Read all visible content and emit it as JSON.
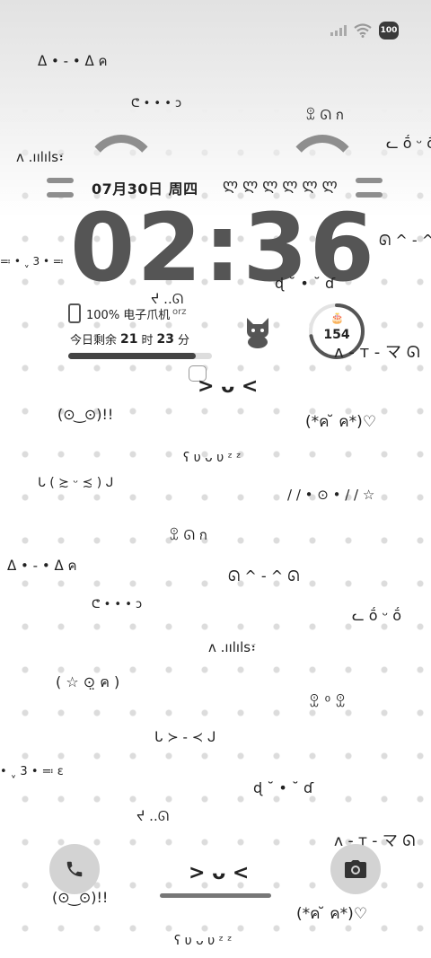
{
  "status_bar": {
    "battery": "100",
    "signal_icon": "signal-icon",
    "wifi_icon": "wifi-icon"
  },
  "lock": {
    "date": "07月30日 周四",
    "header_faces": "ლ ლ ლ ლ ლ ლ",
    "time": "02:36",
    "phone_usage": "100% 电子爪机",
    "orz": "orz",
    "remaining_prefix": "今日剩余",
    "remaining_hours": "21",
    "remaining_hours_unit": "时",
    "remaining_minutes": "23",
    "remaining_minutes_unit": "分",
    "remaining_fraction": 0.89,
    "dial_value": "154",
    "dial_fraction": 0.72
  },
  "kaomoji": {
    "k1": "ᐃ • - • ᐃ ค",
    "k2": "ᕦ • • • ↄ",
    "k3": "ꀾ ᘏ ก",
    "k4": "ᓚ ṓ ᵕ ṓ",
    "k5": "ᴧ .ıılıls፣",
    "k6": "ᘏ ^ - ^ ᘏ",
    "k7": "≕ • ˬ 3 • ≕",
    "k8": "ɖ ˘ • ˘ ɗ",
    "k9": "ᔪ ..ᘏ",
    "k10": "ᴧ - ᴛ - マ ᘏ",
    "k11": "> ᴗ <",
    "k12": "(⊙ ͜ ⊙)!!",
    "k13": "(*ค ̆ ค*)♡",
    "k14": "ʕ υ ᴗ υ ᶻ ᶻ",
    "k15": "ᒐ ( ≿ ᵕ ≾ ) ᒍ",
    "k16": "/ / • ⊙ • / / ☆",
    "k17": "ꀾ ᘏ ก",
    "k18": "ᐃ • - • ᐃ ค",
    "k19": "ᘏ ^ - ^ ᘏ",
    "k20": "ᕦ • • • ↄ",
    "k21": "ᓚ ṓ ᵕ ṓ",
    "k22": "ᴧ .ıılıls፣",
    "k23": "( ☆ ⊙̤ ค )",
    "k24": "ꀾ ⁰ ꀾ",
    "k25": "ᒐ ≻ - ≺ ᒍ",
    "k26": "• ˬ 3 • ≕ ɛ",
    "k27": "ɖ ˘ • ˘ ɗ",
    "k28": "ᔪ ..ᘏ",
    "k29": "ᴧ - ᴛ - マ ᘏ",
    "k30": "> ᴗ <",
    "k31": "(⊙ ͜ ⊙)!!",
    "k32": "(*ค ̆ ค*)♡",
    "k33": "ʕ υ ᴗ υ ᶻ ᶻ"
  },
  "shortcuts": {
    "left_icon": "phone-icon",
    "right_icon": "camera-icon"
  }
}
